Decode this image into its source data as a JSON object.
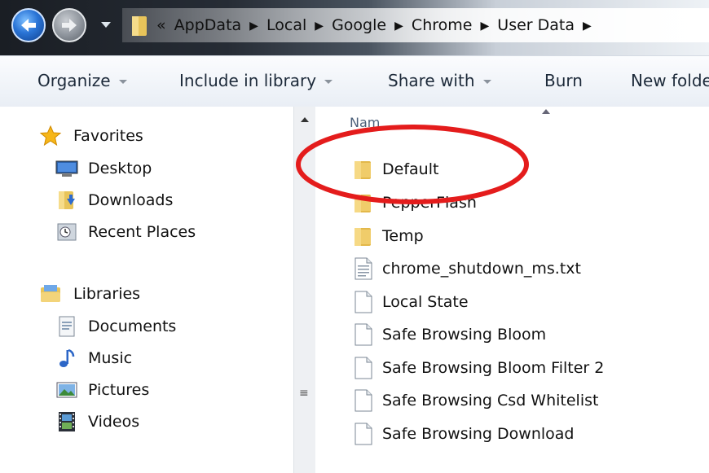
{
  "address_bar": {
    "overflow": "«",
    "crumbs": [
      "AppData",
      "Local",
      "Google",
      "Chrome",
      "User Data"
    ]
  },
  "toolbar": {
    "organize": "Organize",
    "include_in_library": "Include in library",
    "share_with": "Share with",
    "burn": "Burn",
    "new_folder": "New folde"
  },
  "nav": {
    "favorites": "Favorites",
    "desktop": "Desktop",
    "downloads": "Downloads",
    "recent_places": "Recent Places",
    "libraries": "Libraries",
    "documents": "Documents",
    "music": "Music",
    "pictures": "Pictures",
    "videos": "Videos"
  },
  "file_list": {
    "column_name": "Nam",
    "items": [
      {
        "name": "Default",
        "type": "folder"
      },
      {
        "name": "PepperFlash",
        "type": "folder"
      },
      {
        "name": "Temp",
        "type": "folder"
      },
      {
        "name": "chrome_shutdown_ms.txt",
        "type": "text"
      },
      {
        "name": "Local State",
        "type": "file"
      },
      {
        "name": "Safe Browsing Bloom",
        "type": "file"
      },
      {
        "name": "Safe Browsing Bloom Filter 2",
        "type": "file"
      },
      {
        "name": "Safe Browsing Csd Whitelist",
        "type": "file"
      },
      {
        "name": "Safe Browsing Download",
        "type": "file"
      }
    ]
  },
  "highlight": {
    "color": "#e41c1c"
  }
}
